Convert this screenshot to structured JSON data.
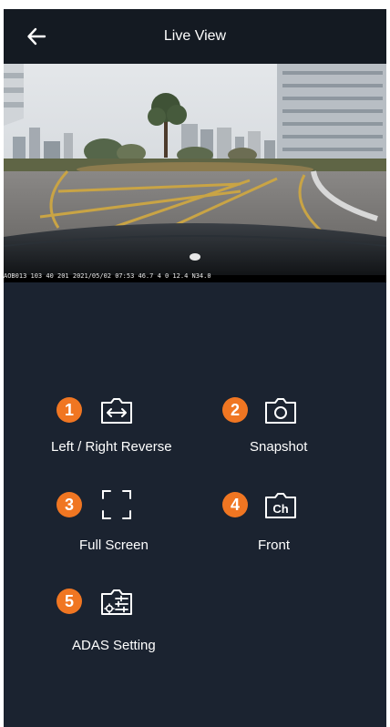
{
  "header": {
    "title": "Live View",
    "back_icon": "arrow-left-icon"
  },
  "video": {
    "osd_text": "AOB013 103 40 201 2021/05/02 07:53 46.7 4 0 12.4 N34.0"
  },
  "controls": [
    {
      "number": "1",
      "label": "Left / Right Reverse",
      "icon": "mirror-swap-icon"
    },
    {
      "number": "2",
      "label": "Snapshot",
      "icon": "camera-icon"
    },
    {
      "number": "3",
      "label": "Full Screen",
      "icon": "fullscreen-icon"
    },
    {
      "number": "4",
      "label": "Front",
      "icon": "channel-icon",
      "icon_text": "Ch"
    },
    {
      "number": "5",
      "label": "ADAS Setting",
      "icon": "adas-settings-icon"
    }
  ],
  "colors": {
    "background": "#1b2330",
    "header": "#141a22",
    "badge": "#f07622",
    "text": "#ffffff"
  }
}
